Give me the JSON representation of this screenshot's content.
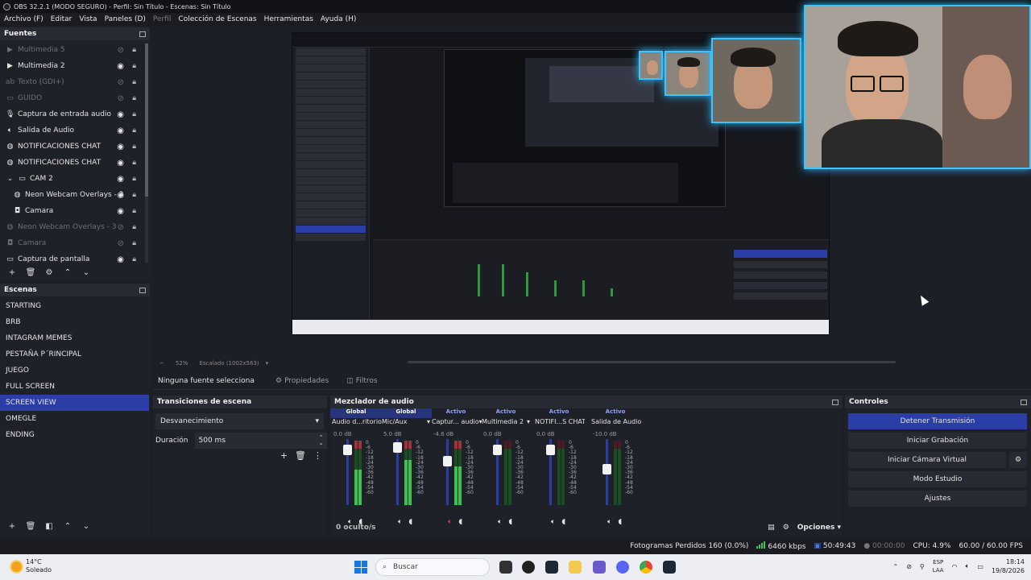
{
  "window": {
    "title": "OBS 32.2.1 (MODO SEGURO) - Perfil: Sin Título - Escenas: Sin Título"
  },
  "menu": [
    "Archivo (F)",
    "Editar",
    "Vista",
    "Paneles (D)",
    "Perfil",
    "Colección de Escenas",
    "Herramientas",
    "Ayuda (H)"
  ],
  "sources": {
    "title": "Fuentes",
    "items": [
      {
        "icon": "play-icon",
        "label": "Multimedia 5"
      },
      {
        "icon": "play-icon",
        "label": "Multimedia 2"
      },
      {
        "icon": "text-icon",
        "label": "Texto (GDI+)"
      },
      {
        "icon": "folder-icon",
        "label": "GUIDO"
      },
      {
        "icon": "mic-icon",
        "label": "Captura de entrada audio"
      },
      {
        "icon": "speaker-icon",
        "label": "Salida de Audio"
      },
      {
        "icon": "browser-icon",
        "label": "NOTIFICACIONES CHAT"
      },
      {
        "icon": "browser-icon",
        "label": "NOTIFICACIONES CHAT"
      },
      {
        "icon": "folder-icon",
        "label": "CAM 2"
      },
      {
        "icon": "browser-icon",
        "label": "Neon Webcam Overlays - 3"
      },
      {
        "icon": "camera-icon",
        "label": "Camara"
      },
      {
        "icon": "browser-icon",
        "label": "Neon Webcam Overlays - 3"
      },
      {
        "icon": "camera-icon",
        "label": "Camara"
      },
      {
        "icon": "monitor-icon",
        "label": "Captura de pantalla"
      }
    ]
  },
  "scenes": {
    "title": "Escenas",
    "items": [
      "STARTING",
      "BRB",
      "INTAGRAM MEMES",
      "PESTAÑA P´RINCIPAL",
      "JUEGO",
      "FULL SCREEN",
      "SCREEN VIEW",
      "OMEGLE",
      "ENDING"
    ],
    "active": "SCREEN VIEW"
  },
  "preview_status": {
    "zoom": "52%",
    "scale": "Escalado (1002x563)"
  },
  "context": {
    "no_source": "Ninguna fuente seleccionada",
    "properties": "Propiedades",
    "filters": "Filtros"
  },
  "transitions": {
    "title": "Transiciones de escena",
    "selected": "Desvanecimiento",
    "duration_label": "Duración",
    "duration_value": "500 ms"
  },
  "mixer": {
    "title": "Mezclador de audio",
    "channels": [
      {
        "tag": "Global",
        "name": "Audio d...ritorio",
        "db": "0.0 dB",
        "level": 0.9,
        "meter": 0.55,
        "muted": false
      },
      {
        "tag": "Global",
        "name": "Mic/Aux",
        "db": "5.0 dB",
        "level": 0.95,
        "meter": 0.7,
        "muted": false
      },
      {
        "tag": "Activo",
        "name": "Captur... audio",
        "db": "-4.6 dB",
        "level": 0.7,
        "meter": 0.6,
        "muted": true
      },
      {
        "tag": "Activo",
        "name": "Multimedia 2",
        "db": "0.0 dB",
        "level": 0.9,
        "meter": 0.0,
        "muted": false
      },
      {
        "tag": "Activo",
        "name": "NOTIFI...S CHAT",
        "db": "0.0 dB",
        "level": 0.9,
        "meter": 0.0,
        "muted": false
      },
      {
        "tag": "Activo",
        "name": "Salida de Audio",
        "db": "-10.0 dB",
        "level": 0.55,
        "meter": 0.0,
        "muted": false
      }
    ],
    "scale": [
      "0",
      "-6",
      "-12",
      "-18",
      "-24",
      "-30",
      "-36",
      "-42",
      "-48",
      "-54",
      "-60"
    ],
    "hidden": "0 oculto/s",
    "options": "Opciones"
  },
  "controls": {
    "title": "Controles",
    "stop_stream": "Detener Transmisión",
    "start_record": "Iniciar Grabación",
    "virtual_cam": "Iniciar Cámara Virtual",
    "studio_mode": "Modo Estudio",
    "settings": "Ajustes"
  },
  "status": {
    "dropped": "Fotogramas Perdidos 160 (0.0%)",
    "bitrate": "6460 kbps",
    "stream_time": "50:49:43",
    "rec_time": "00:00:00",
    "cpu": "CPU: 4.9%",
    "fps": "60.00 / 60.00 FPS"
  },
  "taskbar": {
    "temp": "14°C",
    "weather": "Soleado",
    "search": "Buscar",
    "lang1": "ESP",
    "lang2": "LAA",
    "time": "18:14",
    "date": "19/8/2026"
  },
  "colors": {
    "accent": "#2b3ea8",
    "neon": "#39c6ff",
    "meter_green": "#38c450"
  }
}
